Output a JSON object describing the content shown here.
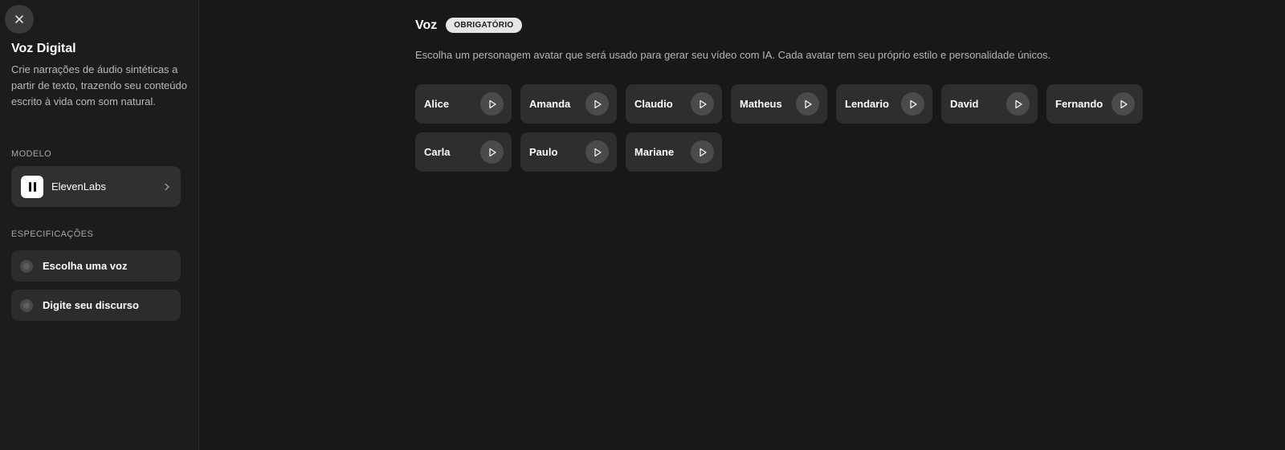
{
  "sidebar": {
    "title": "Voz Digital",
    "description": "Crie narrações de áudio sintéticas a partir de texto, trazendo seu conteúdo escrito à vida com som natural.",
    "model_section_label": "MODELO",
    "model": {
      "name": "ElevenLabs",
      "icon": "elevenlabs-logo"
    },
    "specs_section_label": "ESPECIFICAÇÕES",
    "specs": [
      {
        "label": "Escolha uma voz"
      },
      {
        "label": "Digite seu discurso"
      }
    ]
  },
  "main": {
    "title": "Voz",
    "badge": "OBRIGATÓRIO",
    "description": "Escolha um personagem avatar que será usado para gerar seu vídeo com IA. Cada avatar tem seu próprio estilo e personalidade únicos.",
    "voices": [
      {
        "name": "Alice"
      },
      {
        "name": "Amanda"
      },
      {
        "name": "Claudio"
      },
      {
        "name": "Matheus"
      },
      {
        "name": "Lendario"
      },
      {
        "name": "David"
      },
      {
        "name": "Fernando"
      },
      {
        "name": "Carla"
      },
      {
        "name": "Paulo"
      },
      {
        "name": "Mariane"
      }
    ]
  },
  "colors": {
    "background": "#181818",
    "sidebar": "#1c1c1c",
    "card": "#2e2e2e",
    "badge": "#e6e6e6"
  }
}
